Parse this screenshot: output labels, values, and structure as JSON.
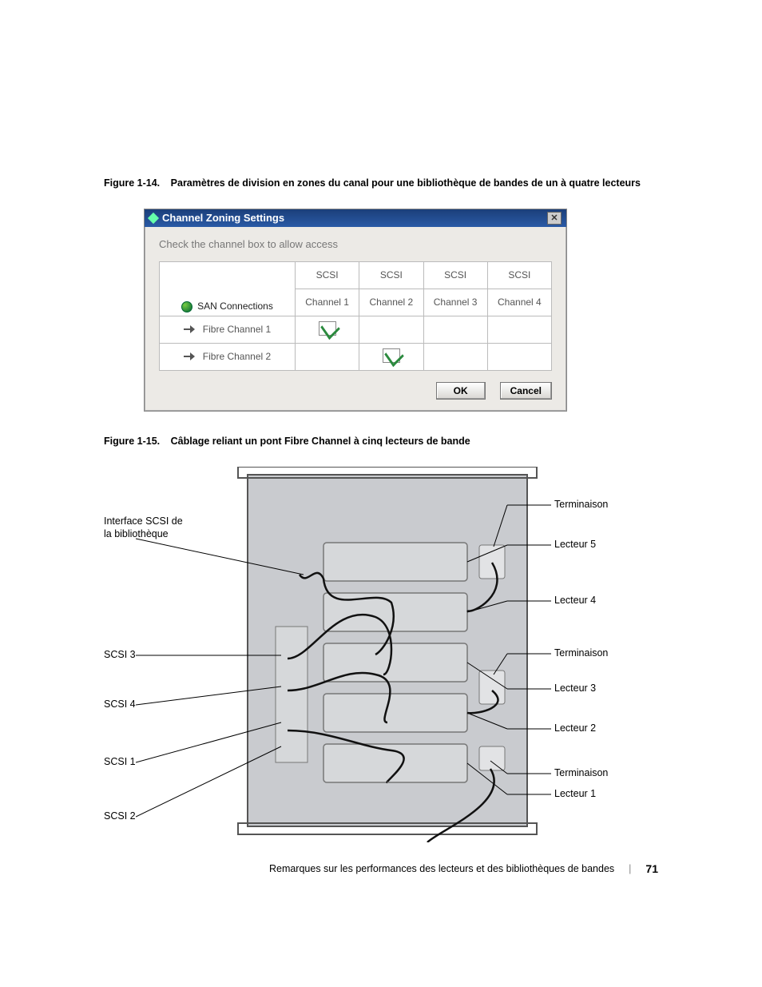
{
  "figure1": {
    "label": "Figure 1-14.",
    "title": "Paramètres de division en zones du canal pour une bibliothèque de bandes de un à quatre lecteurs"
  },
  "dialog": {
    "title": "Channel Zoning Settings",
    "hint": "Check the channel box to allow access",
    "san_header": "SAN Connections",
    "cols": [
      {
        "top": "SCSI",
        "bottom": "Channel 1"
      },
      {
        "top": "SCSI",
        "bottom": "Channel 2"
      },
      {
        "top": "SCSI",
        "bottom": "Channel 3"
      },
      {
        "top": "SCSI",
        "bottom": "Channel 4"
      }
    ],
    "rows": [
      {
        "name": "Fibre Channel 1",
        "checked_col": 0
      },
      {
        "name": "Fibre Channel 2",
        "checked_col": 1
      }
    ],
    "ok": "OK",
    "cancel": "Cancel"
  },
  "figure2": {
    "label": "Figure 1-15.",
    "title": "Câblage reliant un pont Fibre Channel à cinq lecteurs de bande"
  },
  "diagram_labels": {
    "left": {
      "scsi_iface": "Interface SCSI de la bibliothèque",
      "scsi3": "SCSI 3",
      "scsi4": "SCSI 4",
      "scsi1": "SCSI 1",
      "scsi2": "SCSI 2"
    },
    "right": {
      "term1": "Terminaison",
      "lecteur5": "Lecteur 5",
      "lecteur4": "Lecteur 4",
      "term2": "Terminaison",
      "lecteur3": "Lecteur 3",
      "lecteur2": "Lecteur 2",
      "term3": "Terminaison",
      "lecteur1": "Lecteur 1"
    }
  },
  "footer": {
    "text": "Remarques sur les performances des lecteurs et des bibliothèques de bandes",
    "page": "71"
  }
}
